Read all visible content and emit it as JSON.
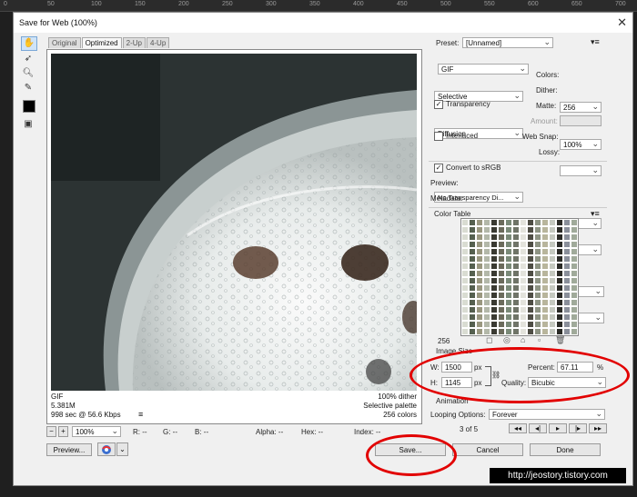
{
  "ruler": {
    "ticks": [
      "0",
      "50",
      "100",
      "150",
      "200",
      "250",
      "300",
      "350",
      "400",
      "450",
      "500",
      "550",
      "600",
      "650",
      "700"
    ]
  },
  "dialog": {
    "title": "Save for Web (100%)",
    "close": "✕"
  },
  "tabs": [
    {
      "label": "Original"
    },
    {
      "label": "Optimized"
    },
    {
      "label": "2-Up"
    },
    {
      "label": "4-Up"
    }
  ],
  "preview_info": {
    "format": "GIF",
    "size": "5.381M",
    "time": "998 sec @ 56.6 Kbps",
    "dither": "100% dither",
    "palette": "Selective palette",
    "colors": "256 colors"
  },
  "statusbar": {
    "zoom": "100%",
    "r": "R: --",
    "g": "G: --",
    "b": "B: --",
    "alpha": "Alpha: --",
    "hex": "Hex: --",
    "index": "Index: --"
  },
  "buttons": {
    "preview": "Preview...",
    "save": "Save...",
    "cancel": "Cancel",
    "done": "Done"
  },
  "settings": {
    "preset_label": "Preset:",
    "preset_value": "[Unnamed]",
    "format": "GIF",
    "reduction": "Selective",
    "colors_label": "Colors:",
    "colors_value": "256",
    "dither_algo": "Diffusion",
    "dither_label": "Dither:",
    "dither_value": "100%",
    "transparency_label": "Transparency",
    "matte_label": "Matte:",
    "transparency_dither": "No Transparency Di...",
    "amount_label": "Amount:",
    "interlaced_label": "Interlaced",
    "websnap_label": "Web Snap:",
    "websnap_value": "0%",
    "lossy_label": "Lossy:",
    "lossy_value": "0",
    "srgb_label": "Convert to sRGB",
    "preview_label": "Preview:",
    "preview_value": "Monitor Color",
    "metadata_label": "Metadata:",
    "metadata_value": "Copyright and Contact Info"
  },
  "color_table": {
    "title": "Color Table",
    "count": "256"
  },
  "image_size": {
    "title": "Image Size",
    "w_label": "W:",
    "w_value": "1500",
    "h_label": "H:",
    "h_value": "1145",
    "unit": "px",
    "percent_label": "Percent:",
    "percent_value": "67.11",
    "percent_unit": "%",
    "quality_label": "Quality:",
    "quality_value": "Bicubic"
  },
  "animation": {
    "title": "Animation",
    "looping_label": "Looping Options:",
    "looping_value": "Forever",
    "frame": "3 of 5"
  },
  "watermark": "http://jeostory.tistory.com",
  "colors": {
    "annotation_red": "#e20000",
    "dialog_bg": "#f0f0f0"
  }
}
